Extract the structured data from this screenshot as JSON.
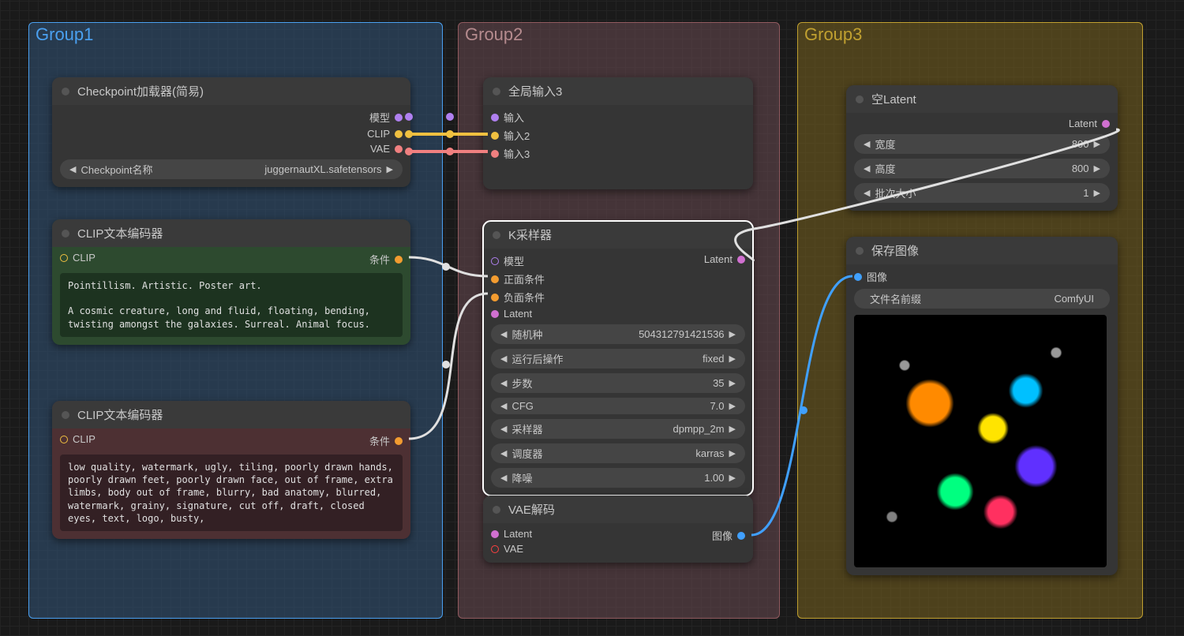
{
  "groups": {
    "g1": {
      "title": "Group1"
    },
    "g2": {
      "title": "Group2"
    },
    "g3": {
      "title": "Group3"
    }
  },
  "nodes": {
    "ckpt": {
      "title": "Checkpoint加载器(简易)",
      "outputs": [
        "模型",
        "CLIP",
        "VAE"
      ],
      "widget": {
        "label": "Checkpoint名称",
        "value": "juggernautXL.safetensors"
      }
    },
    "clip_pos": {
      "title": "CLIP文本编码器",
      "input": "CLIP",
      "output": "条件",
      "text": "Pointillism. Artistic. Poster art.\n\nA cosmic creature, long and fluid, floating, bending, twisting amongst the galaxies. Surreal. Animal focus."
    },
    "clip_neg": {
      "title": "CLIP文本编码器",
      "input": "CLIP",
      "output": "条件",
      "text": "low quality, watermark, ugly, tiling, poorly drawn hands, poorly drawn feet, poorly drawn face, out of frame, extra limbs, body out of frame, blurry, bad anatomy, blurred, watermark, grainy, signature, cut off, draft, closed eyes, text, logo, busty,"
    },
    "reroute": {
      "title": "全局输入3",
      "inputs": [
        "输入",
        "输入2",
        "输入3"
      ]
    },
    "ksampler": {
      "title": "K采样器",
      "inputs": [
        "模型",
        "正面条件",
        "负面条件",
        "Latent"
      ],
      "output_label": "Latent",
      "widgets": [
        {
          "label": "随机种",
          "value": "504312791421536"
        },
        {
          "label": "运行后操作",
          "value": "fixed"
        },
        {
          "label": "步数",
          "value": "35"
        },
        {
          "label": "CFG",
          "value": "7.0"
        },
        {
          "label": "采样器",
          "value": "dpmpp_2m"
        },
        {
          "label": "调度器",
          "value": "karras"
        },
        {
          "label": "降噪",
          "value": "1.00"
        }
      ]
    },
    "vae_decode": {
      "title": "VAE解码",
      "inputs": [
        "Latent",
        "VAE"
      ],
      "output": "图像"
    },
    "empty_latent": {
      "title": "空Latent",
      "output": "Latent",
      "widgets": [
        {
          "label": "宽度",
          "value": "800"
        },
        {
          "label": "高度",
          "value": "800"
        },
        {
          "label": "批次大小",
          "value": "1"
        }
      ]
    },
    "save_image": {
      "title": "保存图像",
      "input": "图像",
      "widget": {
        "label": "文件名前缀",
        "value": "ComfyUI"
      }
    }
  }
}
